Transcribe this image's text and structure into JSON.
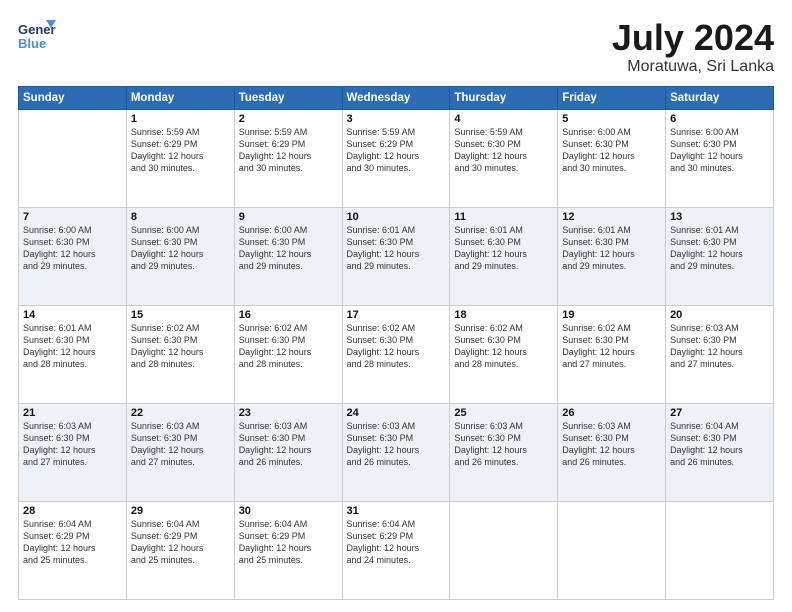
{
  "logo": {
    "line1": "General",
    "line2": "Blue"
  },
  "title": "July 2024",
  "location": "Moratuwa, Sri Lanka",
  "days_header": [
    "Sunday",
    "Monday",
    "Tuesday",
    "Wednesday",
    "Thursday",
    "Friday",
    "Saturday"
  ],
  "weeks": [
    [
      {
        "num": "",
        "info": ""
      },
      {
        "num": "1",
        "info": "Sunrise: 5:59 AM\nSunset: 6:29 PM\nDaylight: 12 hours\nand 30 minutes."
      },
      {
        "num": "2",
        "info": "Sunrise: 5:59 AM\nSunset: 6:29 PM\nDaylight: 12 hours\nand 30 minutes."
      },
      {
        "num": "3",
        "info": "Sunrise: 5:59 AM\nSunset: 6:29 PM\nDaylight: 12 hours\nand 30 minutes."
      },
      {
        "num": "4",
        "info": "Sunrise: 5:59 AM\nSunset: 6:30 PM\nDaylight: 12 hours\nand 30 minutes."
      },
      {
        "num": "5",
        "info": "Sunrise: 6:00 AM\nSunset: 6:30 PM\nDaylight: 12 hours\nand 30 minutes."
      },
      {
        "num": "6",
        "info": "Sunrise: 6:00 AM\nSunset: 6:30 PM\nDaylight: 12 hours\nand 30 minutes."
      }
    ],
    [
      {
        "num": "7",
        "info": "Sunrise: 6:00 AM\nSunset: 6:30 PM\nDaylight: 12 hours\nand 29 minutes."
      },
      {
        "num": "8",
        "info": "Sunrise: 6:00 AM\nSunset: 6:30 PM\nDaylight: 12 hours\nand 29 minutes."
      },
      {
        "num": "9",
        "info": "Sunrise: 6:00 AM\nSunset: 6:30 PM\nDaylight: 12 hours\nand 29 minutes."
      },
      {
        "num": "10",
        "info": "Sunrise: 6:01 AM\nSunset: 6:30 PM\nDaylight: 12 hours\nand 29 minutes."
      },
      {
        "num": "11",
        "info": "Sunrise: 6:01 AM\nSunset: 6:30 PM\nDaylight: 12 hours\nand 29 minutes."
      },
      {
        "num": "12",
        "info": "Sunrise: 6:01 AM\nSunset: 6:30 PM\nDaylight: 12 hours\nand 29 minutes."
      },
      {
        "num": "13",
        "info": "Sunrise: 6:01 AM\nSunset: 6:30 PM\nDaylight: 12 hours\nand 29 minutes."
      }
    ],
    [
      {
        "num": "14",
        "info": "Sunrise: 6:01 AM\nSunset: 6:30 PM\nDaylight: 12 hours\nand 28 minutes."
      },
      {
        "num": "15",
        "info": "Sunrise: 6:02 AM\nSunset: 6:30 PM\nDaylight: 12 hours\nand 28 minutes."
      },
      {
        "num": "16",
        "info": "Sunrise: 6:02 AM\nSunset: 6:30 PM\nDaylight: 12 hours\nand 28 minutes."
      },
      {
        "num": "17",
        "info": "Sunrise: 6:02 AM\nSunset: 6:30 PM\nDaylight: 12 hours\nand 28 minutes."
      },
      {
        "num": "18",
        "info": "Sunrise: 6:02 AM\nSunset: 6:30 PM\nDaylight: 12 hours\nand 28 minutes."
      },
      {
        "num": "19",
        "info": "Sunrise: 6:02 AM\nSunset: 6:30 PM\nDaylight: 12 hours\nand 27 minutes."
      },
      {
        "num": "20",
        "info": "Sunrise: 6:03 AM\nSunset: 6:30 PM\nDaylight: 12 hours\nand 27 minutes."
      }
    ],
    [
      {
        "num": "21",
        "info": "Sunrise: 6:03 AM\nSunset: 6:30 PM\nDaylight: 12 hours\nand 27 minutes."
      },
      {
        "num": "22",
        "info": "Sunrise: 6:03 AM\nSunset: 6:30 PM\nDaylight: 12 hours\nand 27 minutes."
      },
      {
        "num": "23",
        "info": "Sunrise: 6:03 AM\nSunset: 6:30 PM\nDaylight: 12 hours\nand 26 minutes."
      },
      {
        "num": "24",
        "info": "Sunrise: 6:03 AM\nSunset: 6:30 PM\nDaylight: 12 hours\nand 26 minutes."
      },
      {
        "num": "25",
        "info": "Sunrise: 6:03 AM\nSunset: 6:30 PM\nDaylight: 12 hours\nand 26 minutes."
      },
      {
        "num": "26",
        "info": "Sunrise: 6:03 AM\nSunset: 6:30 PM\nDaylight: 12 hours\nand 26 minutes."
      },
      {
        "num": "27",
        "info": "Sunrise: 6:04 AM\nSunset: 6:30 PM\nDaylight: 12 hours\nand 26 minutes."
      }
    ],
    [
      {
        "num": "28",
        "info": "Sunrise: 6:04 AM\nSunset: 6:29 PM\nDaylight: 12 hours\nand 25 minutes."
      },
      {
        "num": "29",
        "info": "Sunrise: 6:04 AM\nSunset: 6:29 PM\nDaylight: 12 hours\nand 25 minutes."
      },
      {
        "num": "30",
        "info": "Sunrise: 6:04 AM\nSunset: 6:29 PM\nDaylight: 12 hours\nand 25 minutes."
      },
      {
        "num": "31",
        "info": "Sunrise: 6:04 AM\nSunset: 6:29 PM\nDaylight: 12 hours\nand 24 minutes."
      },
      {
        "num": "",
        "info": ""
      },
      {
        "num": "",
        "info": ""
      },
      {
        "num": "",
        "info": ""
      }
    ]
  ]
}
